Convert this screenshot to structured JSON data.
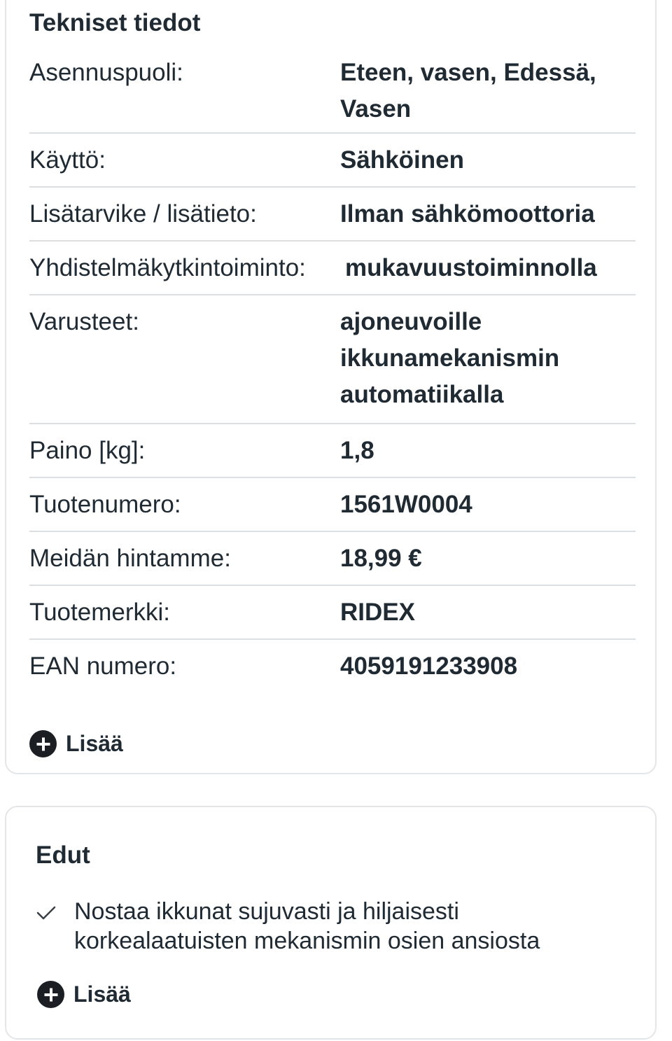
{
  "specs": {
    "title": "Tekniset tiedot",
    "rows": [
      {
        "label": "Asennuspuoli:",
        "value": "Eteen, vasen, Edessä, Vasen"
      },
      {
        "label": "Käyttö:",
        "value": "Sähköinen"
      },
      {
        "label": "Lisätarvike / lisätieto:",
        "value": "Ilman sähkömoottoria"
      },
      {
        "label": "Yhdistelmäkytkintoiminto:",
        "value": "mukavuustoiminnolla"
      },
      {
        "label": "Varusteet:",
        "value": "ajoneuvoille ikkunamekanismin automatiikalla"
      },
      {
        "label": "Paino [kg]:",
        "value": "1,8"
      },
      {
        "label": "Tuotenumero:",
        "value": "1561W0004"
      },
      {
        "label": "Meidän hintamme:",
        "value": "18,99 €"
      },
      {
        "label": "Tuotemerkki:",
        "value": "RIDEX"
      },
      {
        "label": "EAN numero:",
        "value": "4059191233908"
      }
    ],
    "more_label": "Lisää",
    "more_icon": "plus-circle-icon"
  },
  "benefits": {
    "title": "Edut",
    "items": [
      {
        "icon": "check-icon",
        "text": "Nostaa ikkunat sujuvasti ja hiljaisesti korkealaatuisten mekanismin osien ansiosta"
      }
    ],
    "more_label": "Lisää",
    "more_icon": "plus-circle-icon"
  }
}
